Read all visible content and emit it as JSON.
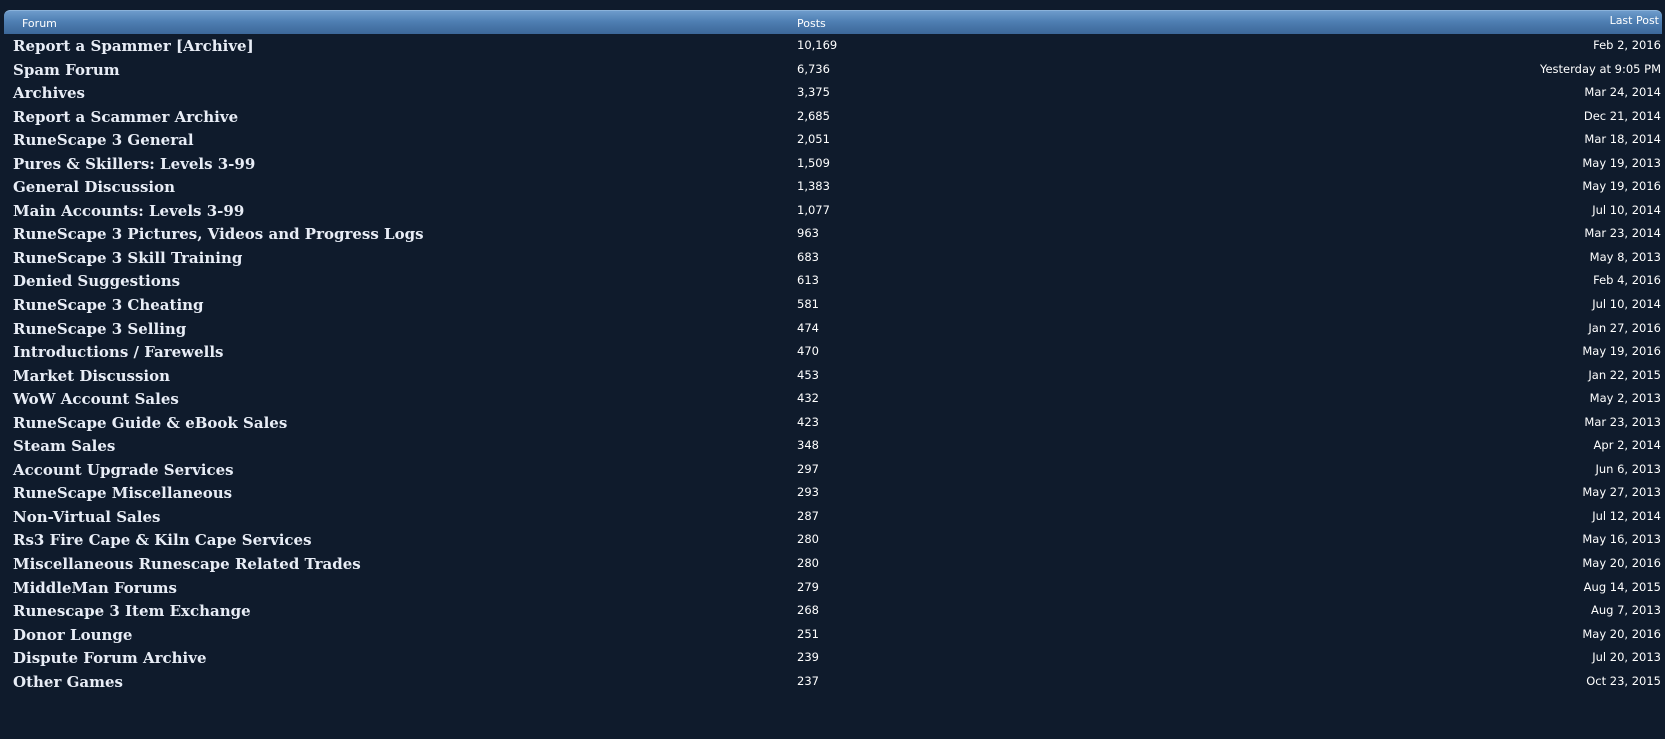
{
  "header": {
    "forum": "Forum",
    "posts": "Posts",
    "last_post": "Last Post"
  },
  "rows": [
    {
      "forum": "Report a Spammer [Archive]",
      "posts": "10,169",
      "last": "Feb 2, 2016"
    },
    {
      "forum": "Spam Forum",
      "posts": "6,736",
      "last": "Yesterday at 9:05 PM"
    },
    {
      "forum": "Archives",
      "posts": "3,375",
      "last": "Mar 24, 2014"
    },
    {
      "forum": "Report a Scammer Archive",
      "posts": "2,685",
      "last": "Dec 21, 2014"
    },
    {
      "forum": "RuneScape 3 General",
      "posts": "2,051",
      "last": "Mar 18, 2014"
    },
    {
      "forum": "Pures & Skillers: Levels 3-99",
      "posts": "1,509",
      "last": "May 19, 2013"
    },
    {
      "forum": "General Discussion",
      "posts": "1,383",
      "last": "May 19, 2016"
    },
    {
      "forum": "Main Accounts: Levels 3-99",
      "posts": "1,077",
      "last": "Jul 10, 2014"
    },
    {
      "forum": "RuneScape 3 Pictures, Videos and Progress Logs",
      "posts": "963",
      "last": "Mar 23, 2014"
    },
    {
      "forum": "RuneScape 3 Skill Training",
      "posts": "683",
      "last": "May 8, 2013"
    },
    {
      "forum": "Denied Suggestions",
      "posts": "613",
      "last": "Feb 4, 2016"
    },
    {
      "forum": "RuneScape 3 Cheating",
      "posts": "581",
      "last": "Jul 10, 2014"
    },
    {
      "forum": "RuneScape 3 Selling",
      "posts": "474",
      "last": "Jan 27, 2016"
    },
    {
      "forum": "Introductions / Farewells",
      "posts": "470",
      "last": "May 19, 2016"
    },
    {
      "forum": "Market Discussion",
      "posts": "453",
      "last": "Jan 22, 2015"
    },
    {
      "forum": "WoW Account Sales",
      "posts": "432",
      "last": "May 2, 2013"
    },
    {
      "forum": "RuneScape Guide & eBook Sales",
      "posts": "423",
      "last": "Mar 23, 2013"
    },
    {
      "forum": "Steam Sales",
      "posts": "348",
      "last": "Apr 2, 2014"
    },
    {
      "forum": "Account Upgrade Services",
      "posts": "297",
      "last": "Jun 6, 2013"
    },
    {
      "forum": "RuneScape Miscellaneous",
      "posts": "293",
      "last": "May 27, 2013"
    },
    {
      "forum": "Non-Virtual Sales",
      "posts": "287",
      "last": "Jul 12, 2014"
    },
    {
      "forum": "Rs3 Fire Cape & Kiln Cape Services",
      "posts": "280",
      "last": "May 16, 2013"
    },
    {
      "forum": "Miscellaneous Runescape Related Trades",
      "posts": "280",
      "last": "May 20, 2016"
    },
    {
      "forum": "MiddleMan Forums",
      "posts": "279",
      "last": "Aug 14, 2015"
    },
    {
      "forum": "Runescape 3 Item Exchange",
      "posts": "268",
      "last": "Aug 7, 2013"
    },
    {
      "forum": "Donor Lounge",
      "posts": "251",
      "last": "May 20, 2016"
    },
    {
      "forum": "Dispute Forum Archive",
      "posts": "239",
      "last": "Jul 20, 2013"
    },
    {
      "forum": "Other Games",
      "posts": "237",
      "last": "Oct 23, 2015"
    }
  ]
}
